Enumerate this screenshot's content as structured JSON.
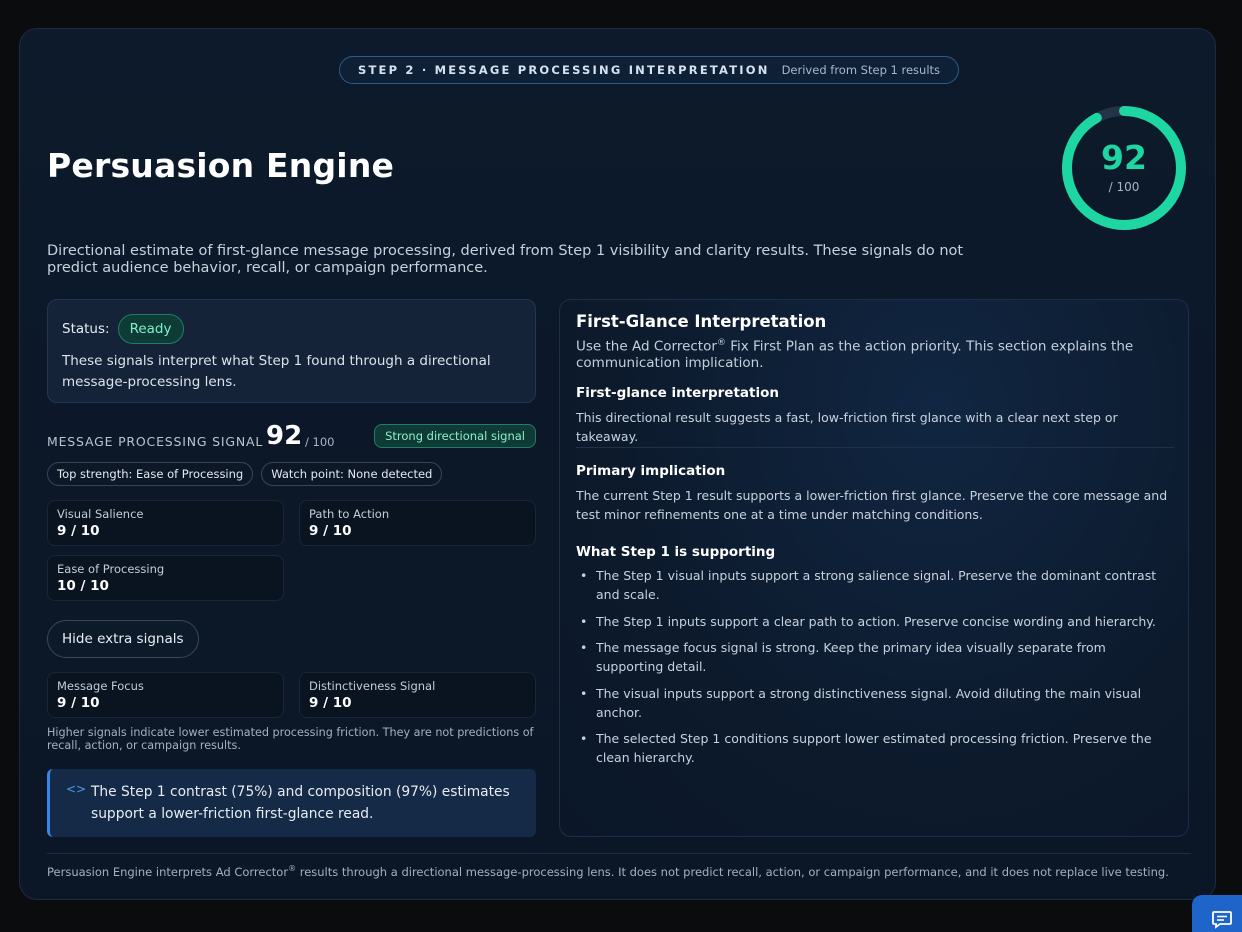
{
  "header": {
    "step_label": "STEP 2 · MESSAGE PROCESSING INTERPRETATION",
    "derived_label": "Derived from Step 1 results",
    "title": "Persuasion Engine",
    "description": "Directional estimate of first-glance message processing, derived from Step 1 visibility and clarity results. These signals do not predict audience behavior, recall, or campaign performance."
  },
  "gauge": {
    "score": "92",
    "denominator": "/ 100",
    "fraction": 0.92,
    "color": "#1ed6a2",
    "track_color": "#243446"
  },
  "status": {
    "label": "Status:",
    "badge": "Ready",
    "text": "These signals interpret what Step 1 found through a directional message-processing lens."
  },
  "signal": {
    "label": "MESSAGE PROCESSING SIGNAL",
    "score": "92",
    "denominator": "/ 100",
    "badge": "Strong directional signal"
  },
  "chips": [
    "Top strength: Ease of Processing",
    "Watch point: None detected"
  ],
  "tiles": [
    {
      "label": "Visual Salience",
      "value": "9 / 10"
    },
    {
      "label": "Path to Action",
      "value": "9 / 10"
    },
    {
      "label": "Ease of Processing",
      "value": "10 / 10"
    },
    {
      "label": "Message Focus",
      "value": "9 / 10"
    },
    {
      "label": "Distinctiveness Signal",
      "value": "9 / 10"
    }
  ],
  "hide_button": "Hide extra signals",
  "note": "Higher signals indicate lower estimated processing friction. They are not predictions of recall, action, or campaign results.",
  "callout": {
    "icon": "code-icon",
    "text": "The Step 1 contrast (75%) and composition (97%) estimates support a lower-friction first-glance read."
  },
  "panel": {
    "title": "First-Glance Interpretation",
    "sub_before": "Use the Ad Corrector",
    "sub_sup": "®",
    "sub_after": " Fix First Plan as the action priority. This section explains the communication implication.",
    "h1": "First-glance interpretation",
    "t1": "This directional result suggests a fast, low-friction first glance with a clear next step or takeaway.",
    "h2": "Primary implication",
    "t2": "The current Step 1 result supports a lower-friction first glance. Preserve the core message and test minor refinements one at a time under matching conditions.",
    "h3": "What Step 1 is supporting",
    "bullets": [
      "The Step 1 visual inputs support a strong salience signal. Preserve the dominant contrast and scale.",
      "The Step 1 inputs support a clear path to action. Preserve concise wording and hierarchy.",
      "The message focus signal is strong. Keep the primary idea visually separate from supporting detail.",
      "The visual inputs support a strong distinctiveness signal. Avoid diluting the main visual anchor.",
      "The selected Step 1 conditions support lower estimated processing friction. Preserve the clean hierarchy."
    ]
  },
  "footer": {
    "before": "Persuasion Engine interprets Ad Corrector",
    "sup": "®",
    "after": " results through a directional message-processing lens. It does not predict recall, action, or campaign performance, and it does not replace live testing."
  },
  "chat_icon": "chat-icon"
}
